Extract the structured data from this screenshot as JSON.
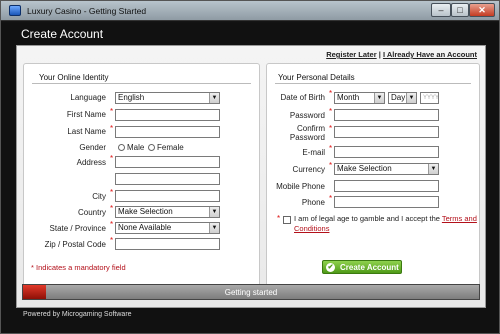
{
  "window": {
    "title": "Luxury Casino - Getting Started",
    "minimize": "–",
    "maximize": "□",
    "close": "✕"
  },
  "page_title": "Create Account",
  "top_links": {
    "register_later": "Register Later",
    "separator": "|",
    "already_have": "I Already Have an Account"
  },
  "identity": {
    "heading": "Your Online Identity",
    "language": {
      "label": "Language",
      "value": "English"
    },
    "first_name": {
      "label": "First Name",
      "value": ""
    },
    "last_name": {
      "label": "Last Name",
      "value": ""
    },
    "gender": {
      "label": "Gender",
      "options": [
        "Male",
        "Female"
      ]
    },
    "address": {
      "label": "Address",
      "value1": "",
      "value2": ""
    },
    "city": {
      "label": "City",
      "value": ""
    },
    "country": {
      "label": "Country",
      "value": "Make Selection"
    },
    "state": {
      "label": "State / Province",
      "value": "None Available"
    },
    "zip": {
      "label": "Zip / Postal Code",
      "value": ""
    }
  },
  "personal": {
    "heading": "Your Personal Details",
    "dob": {
      "label": "Date of Birth",
      "month": "Month",
      "day": "Day",
      "year_placeholder": "YYYY"
    },
    "password": {
      "label": "Password",
      "value": ""
    },
    "confirm_password": {
      "label_line1": "Confirm",
      "label_line2": "Password",
      "value": ""
    },
    "email": {
      "label": "E-mail",
      "value": ""
    },
    "currency": {
      "label": "Currency",
      "value": "Make Selection"
    },
    "mobile": {
      "label": "Mobile Phone",
      "value": ""
    },
    "phone": {
      "label": "Phone",
      "value": ""
    },
    "terms": {
      "text": "I am of legal age to gamble and I accept the",
      "link": "Terms and Conditions"
    }
  },
  "required_marker": "*",
  "mandatory_note": "Indicates a mandatory field",
  "create_button": "Create Account",
  "progress": {
    "label": "Getting started",
    "value": 0.05
  },
  "footer": "Powered by Microgaming Software",
  "colors": {
    "accent_red": "#b3101a",
    "button_green": "#4f9a18",
    "progress_red": "#e23a2a"
  }
}
